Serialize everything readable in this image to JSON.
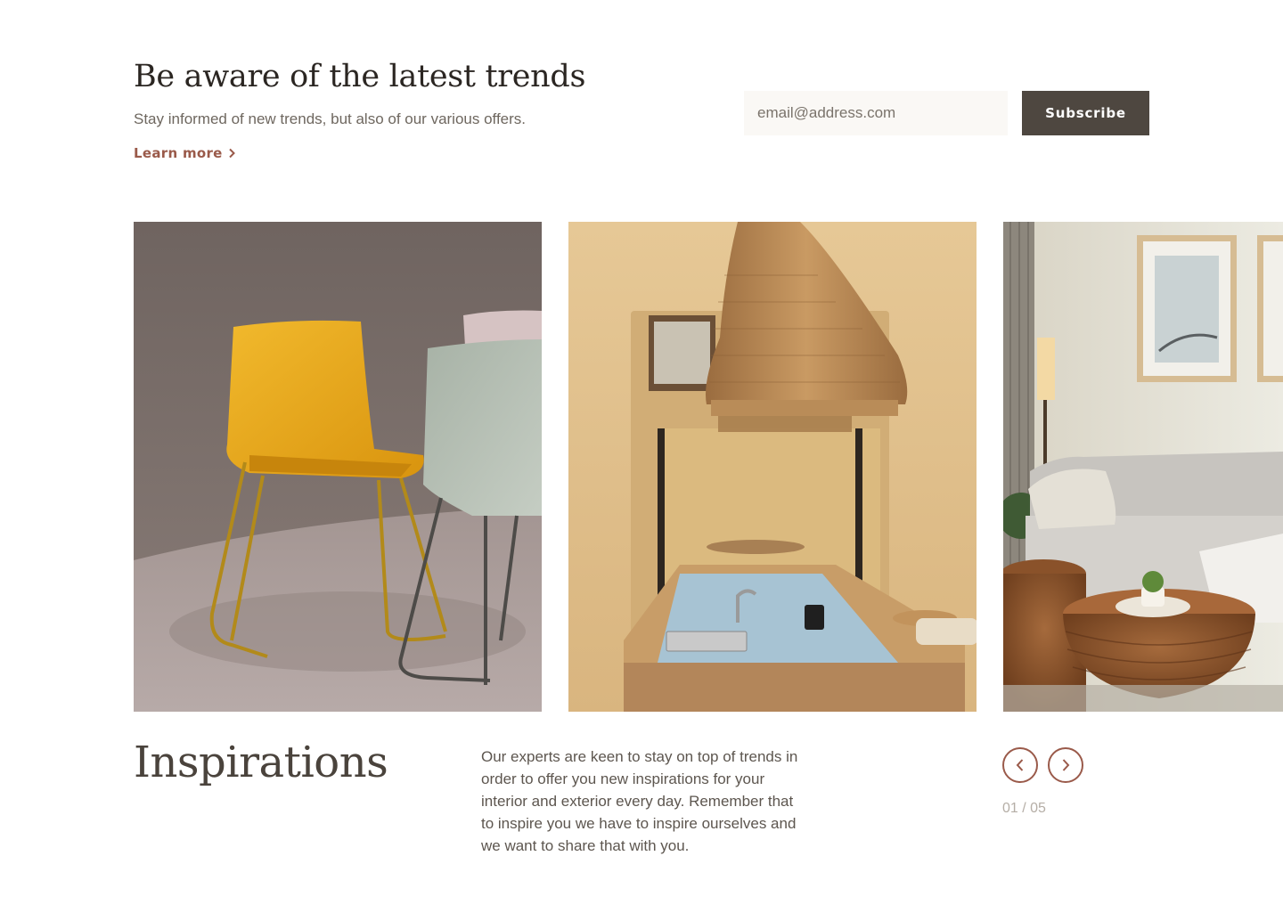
{
  "newsletter": {
    "heading": "Be aware of the latest trends",
    "subtitle": "Stay informed of new trends, but also of our various offers.",
    "learn_more": "Learn more",
    "email_placeholder": "email@address.com",
    "subscribe_label": "Subscribe"
  },
  "slides": [
    {
      "name": "yellow-chair-photo"
    },
    {
      "name": "kitchen-wicker-lamp-photo"
    },
    {
      "name": "living-room-sofa-photo"
    }
  ],
  "inspirations": {
    "title": "Inspirations",
    "text": "Our experts are keen to stay on top of trends in order to offer you new inspirations for your interior and exterior every day. Remember that to inspire you we have to inspire ourselves and we want to share that with you.",
    "pager": "01 / 05"
  },
  "colors": {
    "accent": "#9a5a4a",
    "button_dark": "#4e4740",
    "input_bg": "#faf8f5"
  },
  "icons": {
    "prev": "chevron-left-icon",
    "next": "chevron-right-icon",
    "learn_more": "chevron-right-icon"
  }
}
